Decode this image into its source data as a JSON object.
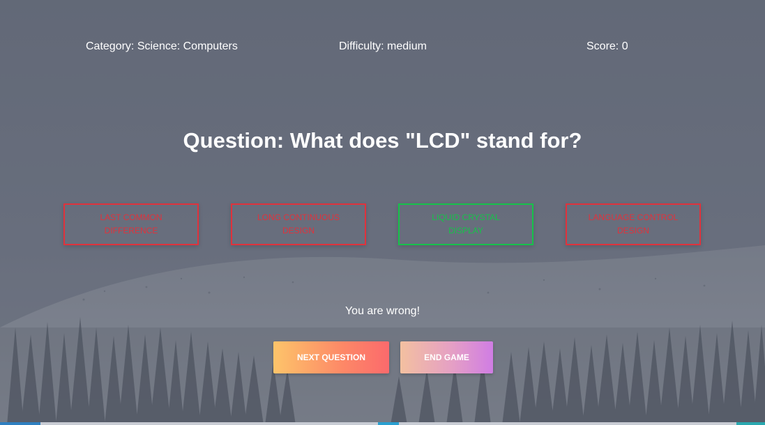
{
  "header": {
    "category": "Category: Science: Computers",
    "difficulty": "Difficulty: medium",
    "score": "Score: 0"
  },
  "question": "Question: What does \"LCD\" stand for?",
  "answers": [
    {
      "label": "LAST COMMON DIFFERENCE",
      "status": "wrong"
    },
    {
      "label": "LONG CONTINUOUS DESIGN",
      "status": "wrong"
    },
    {
      "label": "LIQUID CRYSTAL DISPLAY",
      "status": "correct"
    },
    {
      "label": "LANGUAGE CONTROL DESIGN",
      "status": "wrong"
    }
  ],
  "result": "You are wrong!",
  "buttons": {
    "next": "NEXT QUESTION",
    "end": "END GAME"
  },
  "colors": {
    "wrong": "#e0323c",
    "correct": "#16c24a"
  }
}
